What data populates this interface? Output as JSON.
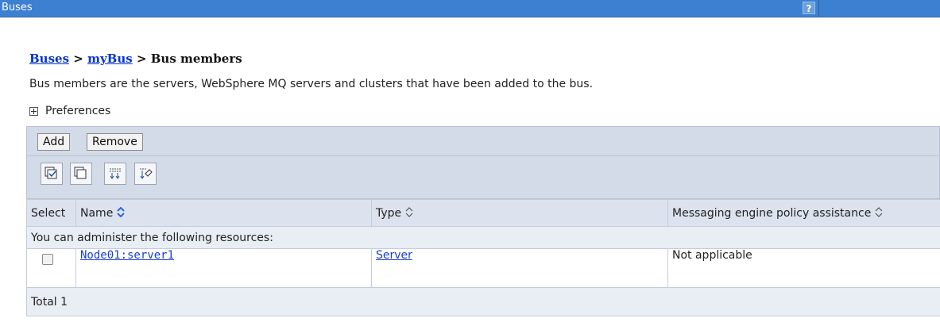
{
  "titlebar": {
    "title": "Buses",
    "help_label": "?"
  },
  "breadcrumb": {
    "buses": "Buses",
    "sep1": ">",
    "mybus": "myBus",
    "sep2": ">",
    "current": "Bus members"
  },
  "description": "Bus members are the servers, WebSphere MQ servers and clusters that have been added to the bus.",
  "preferences_label": "Preferences",
  "toolbar": {
    "add_label": "Add",
    "remove_label": "Remove"
  },
  "icon_toolbar": [
    "select-all-icon",
    "deselect-all-icon",
    "show-filter-icon",
    "clear-filter-icon"
  ],
  "table": {
    "columns": [
      "Select",
      "Name",
      "Type",
      "Messaging engine policy assistance"
    ],
    "subheader": "You can administer the following resources:",
    "rows": [
      {
        "name": "Node01:server1",
        "type": "Server",
        "policy": "Not applicable",
        "selected": false
      }
    ],
    "total": "Total 1"
  },
  "colors": {
    "titlebar": "#3d7fd0",
    "link": "#1a3fc9",
    "band": "#d4dbe8",
    "sort_active": "#2a6ad2"
  }
}
